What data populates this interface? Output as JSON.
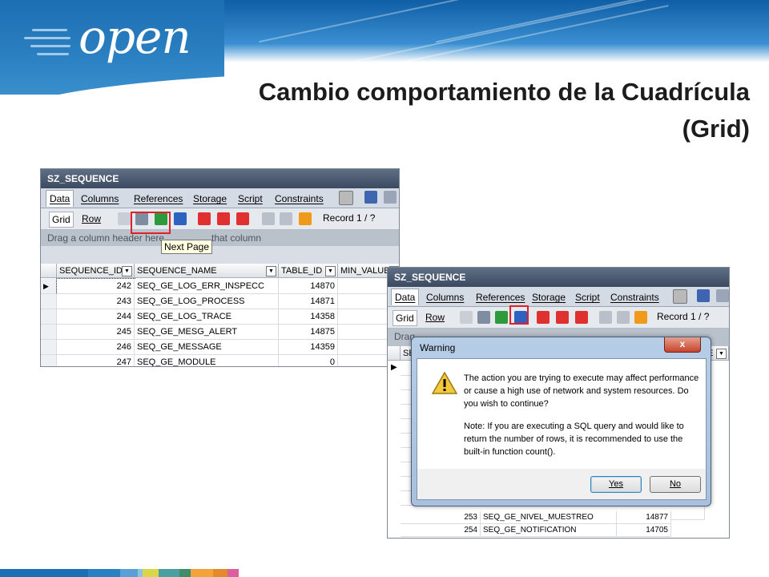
{
  "brand": {
    "logo": "open"
  },
  "slide": {
    "title_line1": "Cambio comportamiento de la Cuadrícula",
    "title_line2": "(Grid)"
  },
  "window1": {
    "title": "SZ_SEQUENCE",
    "tabs": [
      "Data",
      "Columns",
      "References",
      "Storage",
      "Script",
      "Constraints"
    ],
    "subtabs": [
      "Grid",
      "Row"
    ],
    "record": "Record 1 / ?",
    "drag_hint_left": "Drag a column header here",
    "drag_hint_right": "that column",
    "tooltip": "Next Page",
    "columns": [
      "SEQUENCE_ID",
      "SEQUENCE_NAME",
      "TABLE_ID",
      "MIN_VALUE"
    ],
    "rows": [
      {
        "id": "242",
        "name": "SEQ_GE_LOG_ERR_INSPECC",
        "table": "14870"
      },
      {
        "id": "243",
        "name": "SEQ_GE_LOG_PROCESS",
        "table": "14871"
      },
      {
        "id": "244",
        "name": "SEQ_GE_LOG_TRACE",
        "table": "14358"
      },
      {
        "id": "245",
        "name": "SEQ_GE_MESG_ALERT",
        "table": "14875"
      },
      {
        "id": "246",
        "name": "SEQ_GE_MESSAGE",
        "table": "14359"
      },
      {
        "id": "247",
        "name": "SEQ_GE_MODULE",
        "table": "0"
      }
    ]
  },
  "window2": {
    "title": "SZ_SEQUENCE",
    "tabs": [
      "Data",
      "Columns",
      "References",
      "Storage",
      "Script",
      "Constraints"
    ],
    "subtabs": [
      "Grid",
      "Row"
    ],
    "record": "Record 1 / ?",
    "drag_hint": "Drag",
    "col_first": "SE",
    "col_last": "E",
    "rows": [
      {
        "id": "253",
        "name": "SEQ_GE_NIVEL_MUESTREO",
        "table": "14877"
      },
      {
        "id": "254",
        "name": "SEQ_GE_NOTIFICATION",
        "table": "14705"
      }
    ]
  },
  "dialog": {
    "title": "Warning",
    "close": "x",
    "message": "The action you are trying to execute may affect performance or cause a high use of network and system resources. Do you wish to continue?",
    "note": "Note: If you are executing a SQL query and would like to return the number of rows, it is recommended to use the built-in function count().",
    "yes": "Yes",
    "no": "No"
  },
  "colors": {
    "accent_red": "#e0212a",
    "banner_blue": "#1c6fb2",
    "footer": [
      "#1c6fb2",
      "#2b80c2",
      "#5aa0d8",
      "#8fc1e6",
      "#d9d64a",
      "#4aa0a0",
      "#3f8c6c",
      "#f2a43a",
      "#e58a2c",
      "#d9609c"
    ]
  },
  "icons": [
    "first-page-icon",
    "prev-page-icon",
    "next-page-icon",
    "last-page-icon",
    "add-row-icon",
    "delete-row-icon",
    "move-up-icon",
    "post-icon",
    "cancel-edit-icon",
    "refresh-icon",
    "warning-icon"
  ]
}
